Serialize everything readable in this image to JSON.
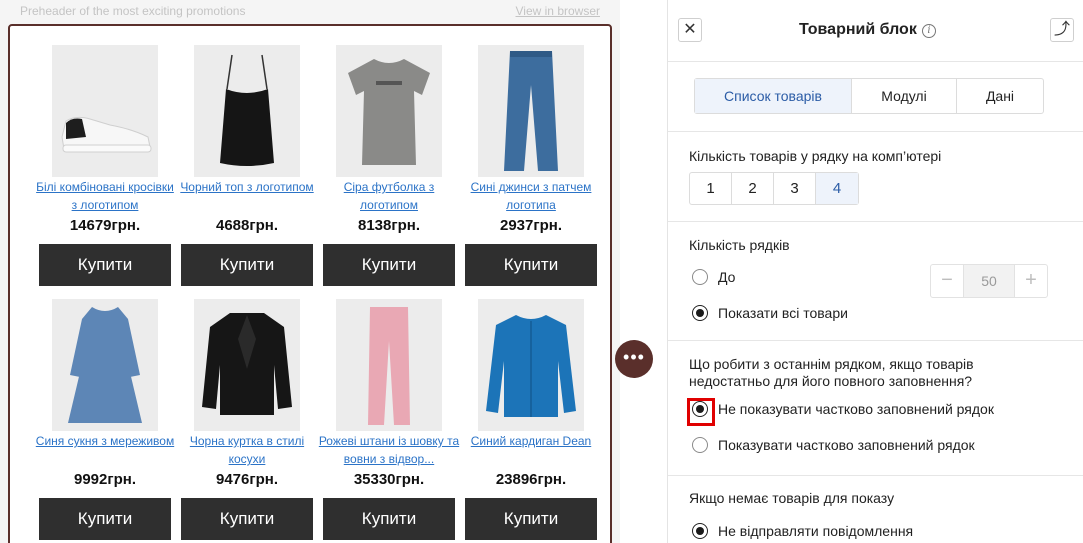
{
  "email": {
    "preheader": "Preheader of the most exciting promotions",
    "view_in_browser": "View in browser",
    "products": [
      {
        "name": "Білі комбіновані кросівки з логотипом",
        "price": "14679грн.",
        "buy": "Купити",
        "icon": "sneaker-image"
      },
      {
        "name": "Чорний топ з логотипом",
        "price": "4688грн.",
        "buy": "Купити",
        "icon": "black-top-image"
      },
      {
        "name": "Сіра футболка з логотипом",
        "price": "8138грн.",
        "buy": "Купити",
        "icon": "grey-tshirt-image"
      },
      {
        "name": "Сині джинси з патчем логотипа",
        "price": "2937грн.",
        "buy": "Купити",
        "icon": "jeans-image"
      },
      {
        "name": "Синя сукня з мереживом",
        "price": "9992грн.",
        "buy": "Купити",
        "icon": "blue-dress-image"
      },
      {
        "name": "Чорна куртка в стилі косухи",
        "price": "9476грн.",
        "buy": "Купити",
        "icon": "leather-jacket-image"
      },
      {
        "name": "Рожеві штани із шовку та вовни з відвор...",
        "price": "35330грн.",
        "buy": "Купити",
        "icon": "pink-trousers-image"
      },
      {
        "name": "Синий кардиган Dean",
        "price": "23896грн.",
        "buy": "Купити",
        "icon": "blue-cardigan-image"
      }
    ]
  },
  "fab": {
    "label": "•••"
  },
  "panel": {
    "title": "Товарний блок",
    "close_glyph": "✕",
    "export_glyph": "⤴",
    "info_glyph": "i",
    "tabs": [
      {
        "label": "Список товарів",
        "active": true
      },
      {
        "label": "Модулі",
        "active": false
      },
      {
        "label": "Дані",
        "active": false
      }
    ],
    "per_row": {
      "label": "Кількість товарів у рядку на комп’ютері",
      "options": [
        "1",
        "2",
        "3",
        "4"
      ],
      "selected": "4"
    },
    "rows": {
      "label": "Кількість рядків",
      "option_up_to": "До",
      "option_all": "Показати всі товари",
      "selected": "all",
      "stepper_minus": "−",
      "stepper_value": "50",
      "stepper_plus": "+"
    },
    "last_row": {
      "label": "Що робити з останнім рядком, якщо товарів недостатньо для його повного заповнення?",
      "option_hide": "Не показувати частково заповнений рядок",
      "option_show": "Показувати частково заповнений рядок",
      "selected": "hide"
    },
    "no_products": {
      "label": "Якщо немає товарів для показу",
      "option_dont_send": "Не відправляти повідомлення",
      "selected": "dont_send"
    }
  },
  "colors": {
    "accent_border": "#5a2f2b",
    "link": "#2b73c7",
    "buy_button": "#2f2f2f",
    "highlight": "#e00000",
    "active_tab": "#eef3fb"
  }
}
